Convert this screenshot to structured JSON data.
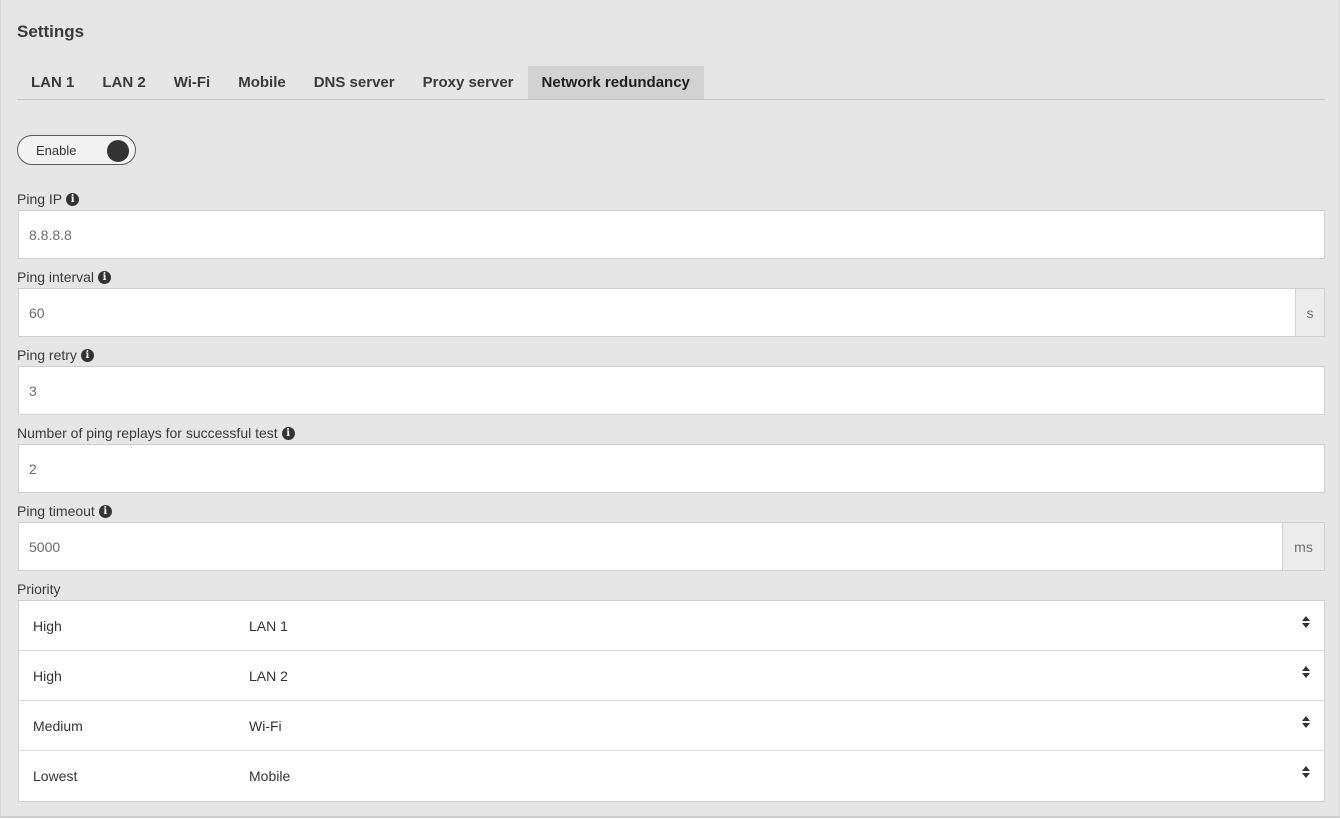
{
  "page": {
    "title": "Settings"
  },
  "tabs": [
    {
      "label": "LAN 1"
    },
    {
      "label": "LAN 2"
    },
    {
      "label": "Wi-Fi"
    },
    {
      "label": "Mobile"
    },
    {
      "label": "DNS server"
    },
    {
      "label": "Proxy server"
    },
    {
      "label": "Network redundancy",
      "active": true
    }
  ],
  "toggle": {
    "label": "Enable",
    "state": "on"
  },
  "fields": {
    "ping_ip": {
      "label": "Ping IP",
      "value": "8.8.8.8"
    },
    "ping_interval": {
      "label": "Ping interval",
      "value": "60",
      "unit": "s"
    },
    "ping_retry": {
      "label": "Ping retry",
      "value": "3"
    },
    "ping_replays": {
      "label": "Number of ping replays for successful test",
      "value": "2"
    },
    "ping_timeout": {
      "label": "Ping timeout",
      "value": "5000",
      "unit": "ms"
    }
  },
  "priority": {
    "label": "Priority",
    "rows": [
      {
        "level": "High",
        "interface": "LAN 1"
      },
      {
        "level": "High",
        "interface": "LAN 2"
      },
      {
        "level": "Medium",
        "interface": "Wi-Fi"
      },
      {
        "level": "Lowest",
        "interface": "Mobile"
      }
    ]
  },
  "icons": {
    "info": "info-icon",
    "sort": "sort-icon",
    "info_glyph": "i"
  },
  "colors": {
    "panel_bg": "#e6e6e6",
    "active_tab_bg": "#d2d2d2",
    "toggle_knob": "#333333"
  }
}
